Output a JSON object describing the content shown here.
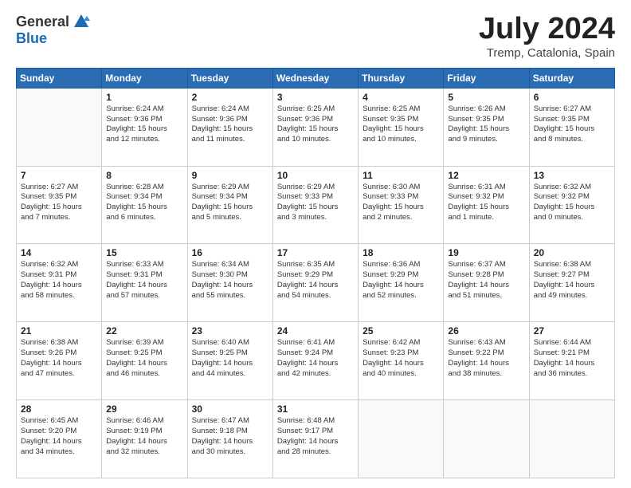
{
  "logo": {
    "general": "General",
    "blue": "Blue"
  },
  "title": "July 2024",
  "subtitle": "Tremp, Catalonia, Spain",
  "headers": [
    "Sunday",
    "Monday",
    "Tuesday",
    "Wednesday",
    "Thursday",
    "Friday",
    "Saturday"
  ],
  "weeks": [
    [
      {
        "day": "",
        "info": ""
      },
      {
        "day": "1",
        "info": "Sunrise: 6:24 AM\nSunset: 9:36 PM\nDaylight: 15 hours\nand 12 minutes."
      },
      {
        "day": "2",
        "info": "Sunrise: 6:24 AM\nSunset: 9:36 PM\nDaylight: 15 hours\nand 11 minutes."
      },
      {
        "day": "3",
        "info": "Sunrise: 6:25 AM\nSunset: 9:36 PM\nDaylight: 15 hours\nand 10 minutes."
      },
      {
        "day": "4",
        "info": "Sunrise: 6:25 AM\nSunset: 9:35 PM\nDaylight: 15 hours\nand 10 minutes."
      },
      {
        "day": "5",
        "info": "Sunrise: 6:26 AM\nSunset: 9:35 PM\nDaylight: 15 hours\nand 9 minutes."
      },
      {
        "day": "6",
        "info": "Sunrise: 6:27 AM\nSunset: 9:35 PM\nDaylight: 15 hours\nand 8 minutes."
      }
    ],
    [
      {
        "day": "7",
        "info": "Sunrise: 6:27 AM\nSunset: 9:35 PM\nDaylight: 15 hours\nand 7 minutes."
      },
      {
        "day": "8",
        "info": "Sunrise: 6:28 AM\nSunset: 9:34 PM\nDaylight: 15 hours\nand 6 minutes."
      },
      {
        "day": "9",
        "info": "Sunrise: 6:29 AM\nSunset: 9:34 PM\nDaylight: 15 hours\nand 5 minutes."
      },
      {
        "day": "10",
        "info": "Sunrise: 6:29 AM\nSunset: 9:33 PM\nDaylight: 15 hours\nand 3 minutes."
      },
      {
        "day": "11",
        "info": "Sunrise: 6:30 AM\nSunset: 9:33 PM\nDaylight: 15 hours\nand 2 minutes."
      },
      {
        "day": "12",
        "info": "Sunrise: 6:31 AM\nSunset: 9:32 PM\nDaylight: 15 hours\nand 1 minute."
      },
      {
        "day": "13",
        "info": "Sunrise: 6:32 AM\nSunset: 9:32 PM\nDaylight: 15 hours\nand 0 minutes."
      }
    ],
    [
      {
        "day": "14",
        "info": "Sunrise: 6:32 AM\nSunset: 9:31 PM\nDaylight: 14 hours\nand 58 minutes."
      },
      {
        "day": "15",
        "info": "Sunrise: 6:33 AM\nSunset: 9:31 PM\nDaylight: 14 hours\nand 57 minutes."
      },
      {
        "day": "16",
        "info": "Sunrise: 6:34 AM\nSunset: 9:30 PM\nDaylight: 14 hours\nand 55 minutes."
      },
      {
        "day": "17",
        "info": "Sunrise: 6:35 AM\nSunset: 9:29 PM\nDaylight: 14 hours\nand 54 minutes."
      },
      {
        "day": "18",
        "info": "Sunrise: 6:36 AM\nSunset: 9:29 PM\nDaylight: 14 hours\nand 52 minutes."
      },
      {
        "day": "19",
        "info": "Sunrise: 6:37 AM\nSunset: 9:28 PM\nDaylight: 14 hours\nand 51 minutes."
      },
      {
        "day": "20",
        "info": "Sunrise: 6:38 AM\nSunset: 9:27 PM\nDaylight: 14 hours\nand 49 minutes."
      }
    ],
    [
      {
        "day": "21",
        "info": "Sunrise: 6:38 AM\nSunset: 9:26 PM\nDaylight: 14 hours\nand 47 minutes."
      },
      {
        "day": "22",
        "info": "Sunrise: 6:39 AM\nSunset: 9:25 PM\nDaylight: 14 hours\nand 46 minutes."
      },
      {
        "day": "23",
        "info": "Sunrise: 6:40 AM\nSunset: 9:25 PM\nDaylight: 14 hours\nand 44 minutes."
      },
      {
        "day": "24",
        "info": "Sunrise: 6:41 AM\nSunset: 9:24 PM\nDaylight: 14 hours\nand 42 minutes."
      },
      {
        "day": "25",
        "info": "Sunrise: 6:42 AM\nSunset: 9:23 PM\nDaylight: 14 hours\nand 40 minutes."
      },
      {
        "day": "26",
        "info": "Sunrise: 6:43 AM\nSunset: 9:22 PM\nDaylight: 14 hours\nand 38 minutes."
      },
      {
        "day": "27",
        "info": "Sunrise: 6:44 AM\nSunset: 9:21 PM\nDaylight: 14 hours\nand 36 minutes."
      }
    ],
    [
      {
        "day": "28",
        "info": "Sunrise: 6:45 AM\nSunset: 9:20 PM\nDaylight: 14 hours\nand 34 minutes."
      },
      {
        "day": "29",
        "info": "Sunrise: 6:46 AM\nSunset: 9:19 PM\nDaylight: 14 hours\nand 32 minutes."
      },
      {
        "day": "30",
        "info": "Sunrise: 6:47 AM\nSunset: 9:18 PM\nDaylight: 14 hours\nand 30 minutes."
      },
      {
        "day": "31",
        "info": "Sunrise: 6:48 AM\nSunset: 9:17 PM\nDaylight: 14 hours\nand 28 minutes."
      },
      {
        "day": "",
        "info": ""
      },
      {
        "day": "",
        "info": ""
      },
      {
        "day": "",
        "info": ""
      }
    ]
  ]
}
